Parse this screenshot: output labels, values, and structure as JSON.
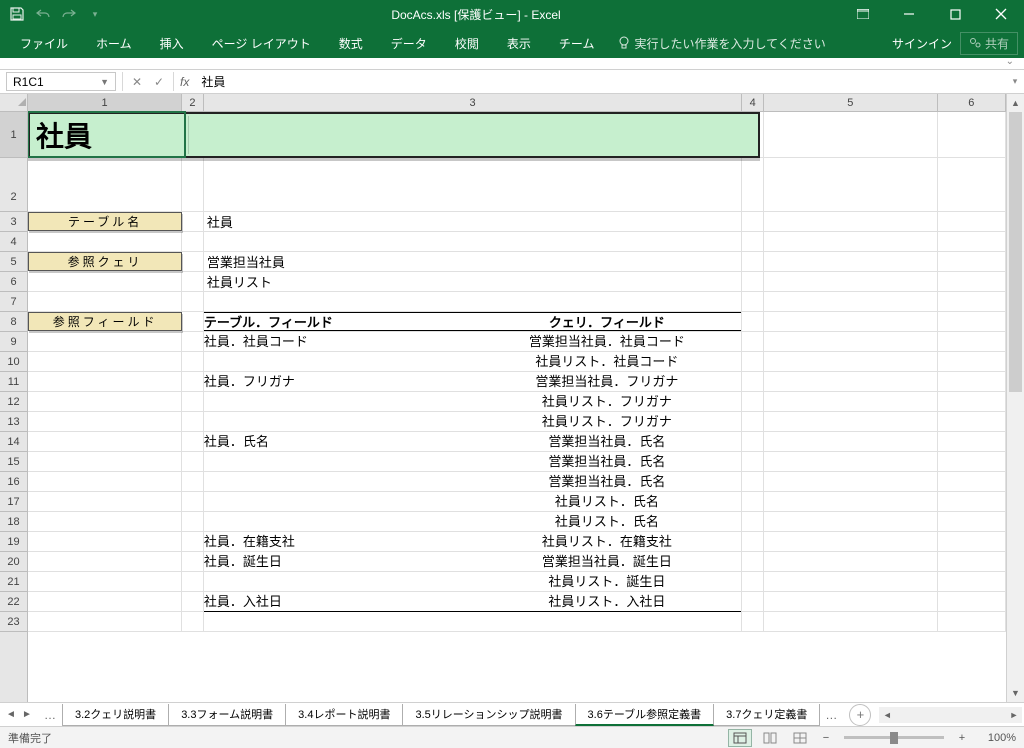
{
  "app": {
    "title": "DocAcs.xls  [保護ビュー] - Excel",
    "signin": "サインイン",
    "share": "共有"
  },
  "ribbon": {
    "tabs": [
      "ファイル",
      "ホーム",
      "挿入",
      "ページ レイアウト",
      "数式",
      "データ",
      "校閲",
      "表示",
      "チーム"
    ],
    "tell": "実行したい作業を入力してください"
  },
  "fx": {
    "namebox": "R1C1",
    "value": "社員"
  },
  "columns": [
    "1",
    "2",
    "3",
    "4",
    "5",
    "6"
  ],
  "sheet": {
    "title": "社員",
    "labels": {
      "table_name": "テーブル名",
      "ref_query": "参照クェリ",
      "ref_field": "参照フィールド"
    },
    "table_name_value": "社員",
    "ref_queries": [
      "営業担当社員",
      "社員リスト"
    ],
    "field_header": {
      "left": "テーブル．フィールド",
      "right": "クェリ．フィールド"
    },
    "rows": [
      {
        "left": "社員．社員コード",
        "right": "営業担当社員．社員コード"
      },
      {
        "left": "",
        "right": "社員リスト．社員コード"
      },
      {
        "left": "社員．フリガナ",
        "right": "営業担当社員．フリガナ"
      },
      {
        "left": "",
        "right": "社員リスト．フリガナ"
      },
      {
        "left": "",
        "right": "社員リスト．フリガナ"
      },
      {
        "left": "社員．氏名",
        "right": "営業担当社員．氏名"
      },
      {
        "left": "",
        "right": "営業担当社員．氏名"
      },
      {
        "left": "",
        "right": "営業担当社員．氏名"
      },
      {
        "left": "",
        "right": "社員リスト．氏名"
      },
      {
        "left": "",
        "right": "社員リスト．氏名"
      },
      {
        "left": "社員．在籍支社",
        "right": "社員リスト．在籍支社"
      },
      {
        "left": "社員．誕生日",
        "right": "営業担当社員．誕生日"
      },
      {
        "left": "",
        "right": "社員リスト．誕生日"
      },
      {
        "left": "社員．入社日",
        "right": "社員リスト．入社日"
      }
    ]
  },
  "tabs": {
    "items": [
      "3.2クェリ説明書",
      "3.3フォーム説明書",
      "3.4レポート説明書",
      "3.5リレーションシップ説明書",
      "3.6テーブル参照定義書",
      "3.7クェリ定義書"
    ],
    "active_index": 4
  },
  "status": {
    "ready": "準備完了",
    "zoom": "100%"
  }
}
